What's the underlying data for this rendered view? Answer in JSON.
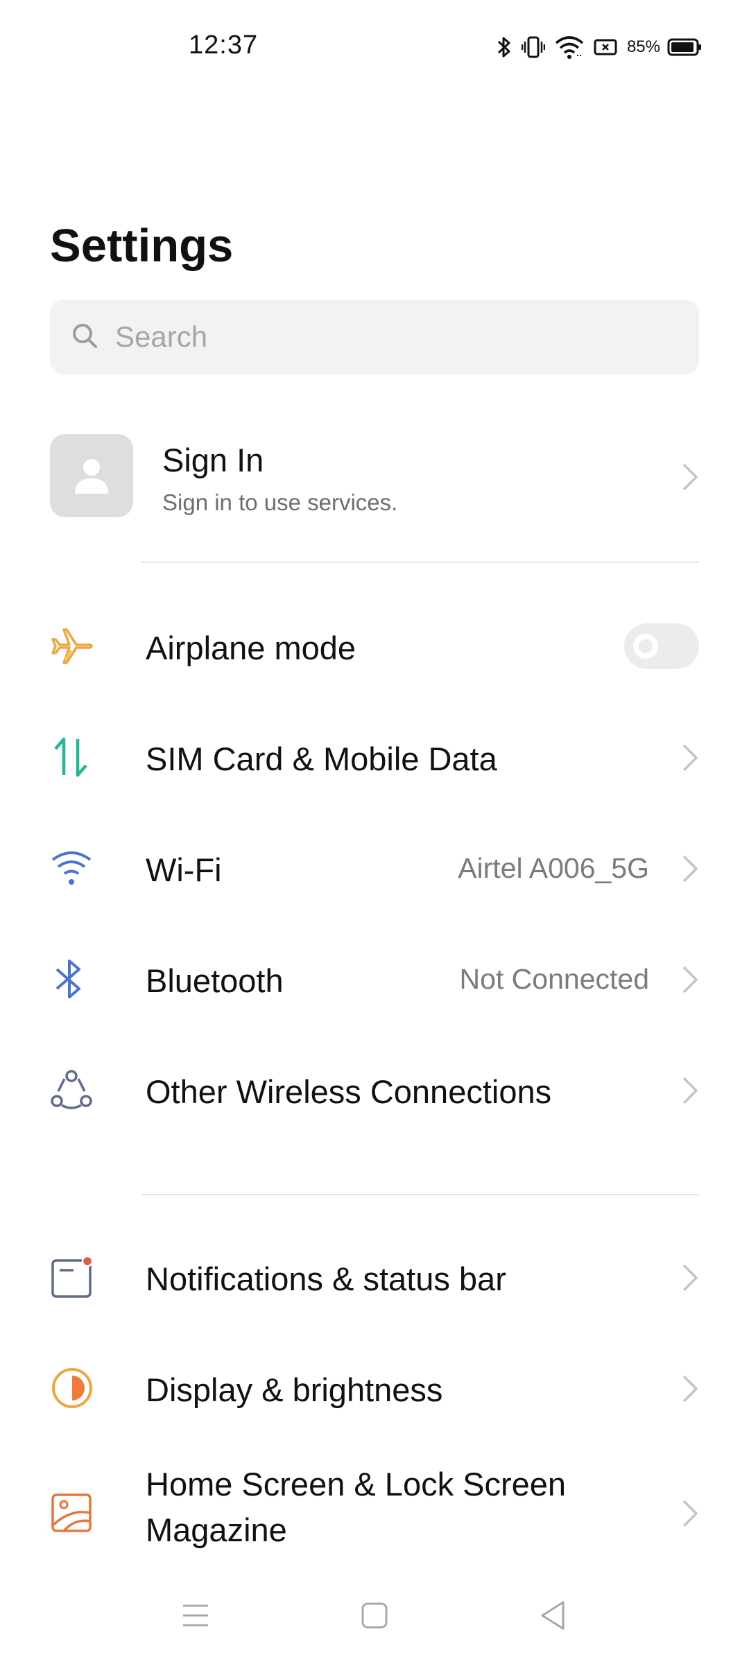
{
  "status_bar": {
    "time": "12:37",
    "battery_percent": "85%",
    "icons": [
      "bluetooth-icon",
      "vibrate-icon",
      "wifi-icon",
      "battery-saver-icon",
      "battery-icon"
    ]
  },
  "page": {
    "title": "Settings"
  },
  "search": {
    "placeholder": "Search",
    "value": ""
  },
  "account": {
    "title": "Sign In",
    "subtitle": "Sign in to use services."
  },
  "settings": [
    {
      "label": "Airplane mode",
      "icon": "airplane-icon",
      "toggle": false
    },
    {
      "label": "SIM Card & Mobile Data",
      "icon": "mobile-data-icon"
    },
    {
      "label": "Wi-Fi",
      "value": "Airtel A006_5G",
      "icon": "wifi-icon"
    },
    {
      "label": "Bluetooth",
      "value": "Not Connected",
      "icon": "bluetooth-icon"
    },
    {
      "label": "Other Wireless Connections",
      "icon": "connections-icon"
    },
    {
      "label": "Notifications & status bar",
      "icon": "notification-icon"
    },
    {
      "label": "Display & brightness",
      "icon": "brightness-icon"
    },
    {
      "label_line1": "Home Screen & Lock Screen",
      "label_line2": "Magazine",
      "icon": "wallpaper-icon"
    }
  ],
  "nav": [
    "menu-icon",
    "home-icon",
    "back-icon"
  ],
  "colors": {
    "accent_orange": "#f0a640",
    "accent_teal": "#27b59a",
    "accent_blue": "#4a73d6",
    "accent_red": "#e55b4a",
    "search_bg": "#f2f2f2",
    "divider": "#e6e6e6"
  }
}
